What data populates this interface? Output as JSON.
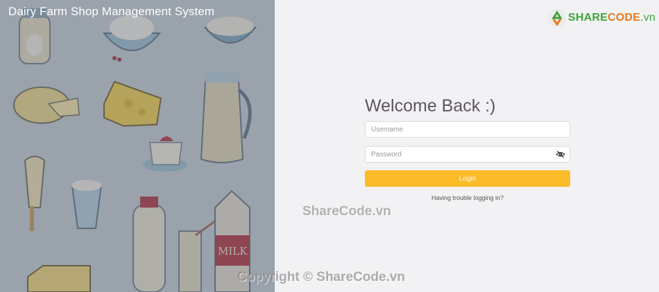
{
  "app": {
    "title": "Dairy Farm Shop Management System"
  },
  "branding": {
    "logo_share": "SHARE",
    "logo_code": "CODE",
    "logo_tld": ".vn"
  },
  "login": {
    "heading": "Welcome Back :)",
    "username_placeholder": "Username",
    "password_placeholder": "Password",
    "login_label": "Login",
    "trouble_link": "Having trouble logging in?"
  },
  "watermarks": {
    "center": "ShareCode.vn",
    "bottom": "Copyright © ShareCode.vn"
  },
  "colors": {
    "accent": "#fbbc2a",
    "logo_green": "#3fa538",
    "logo_orange": "#e8791c"
  },
  "icons": {
    "password_toggle": "eye-off-icon",
    "logo_mark": "recycle-logo-icon"
  }
}
